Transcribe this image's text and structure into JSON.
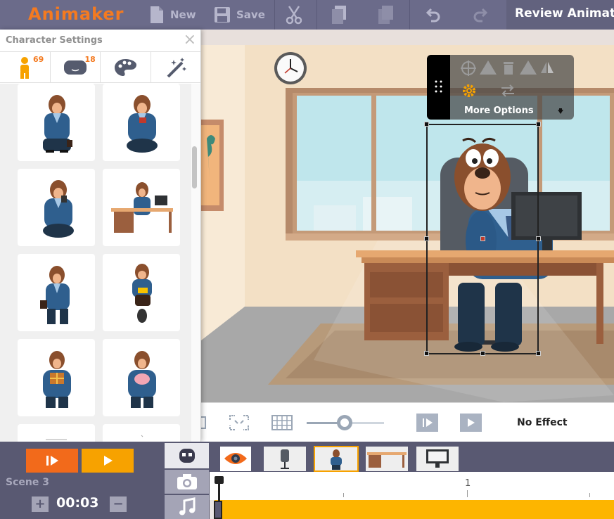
{
  "app": {
    "logo": "Animaker",
    "project_title": "Review Animat"
  },
  "toolbar": {
    "new_label": "New",
    "save_label": "Save",
    "icons": [
      "file-icon",
      "save-icon",
      "scissors-icon",
      "copy-icon",
      "paste-icon",
      "undo-icon",
      "redo-icon"
    ]
  },
  "character_panel": {
    "title": "Character Settings",
    "close_glyph": "×",
    "tabs": [
      {
        "icon": "character-icon",
        "badge": "69"
      },
      {
        "icon": "props-icon",
        "badge": "18"
      },
      {
        "icon": "palette-icon",
        "badge": ""
      },
      {
        "icon": "magic-wand-icon",
        "badge": ""
      }
    ],
    "grid_items": [
      "character-pose-thinking",
      "character-pose-reading-phone",
      "character-pose-talking-phone",
      "character-pose-at-desk",
      "character-pose-briefcase",
      "character-pose-scooter",
      "character-pose-gift",
      "character-pose-piggy-bank",
      "character-pose-partial",
      "character-pose-partial"
    ]
  },
  "float_menu": {
    "label": "More Options",
    "icons": [
      "move-icon",
      "delete-icon",
      "flip-icon",
      "gear-icon",
      "swap-icon",
      "chevron-down-icon"
    ]
  },
  "stage_toolbar": {
    "icons": [
      "fit-icon",
      "fullscreen-icon",
      "grid-icon",
      "zoom-slider",
      "step-play-icon",
      "play-icon"
    ],
    "zoom_level": 0.5,
    "effect_label": "No Effect"
  },
  "scene": {
    "label": "Scene 3",
    "duration": "00:03",
    "plus": "+",
    "minus": "−"
  },
  "timeline": {
    "tabs": [
      "character-tab-icon",
      "camera-icon",
      "music-icon"
    ],
    "thumbnails": [
      "eye-icon",
      "chair-thumb",
      "character-thumb",
      "desk-thumb",
      "monitor-thumb"
    ],
    "ruler_label": "1"
  },
  "colors": {
    "accent_orange": "#f47a20",
    "play_orange": "#f26a1b",
    "play_yellow": "#f7a200",
    "track_yellow": "#fdb500",
    "topbar": "#6b6b8a",
    "bottom_panel": "#595972"
  }
}
